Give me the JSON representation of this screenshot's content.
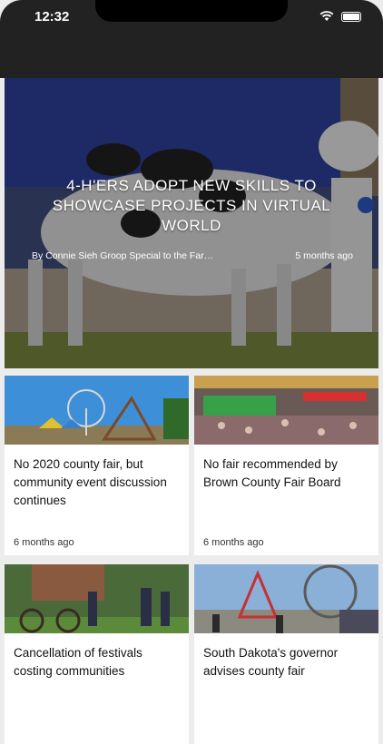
{
  "status_bar": {
    "time": "12:32"
  },
  "hero": {
    "title": "4-H'ERS ADOPT NEW SKILLS TO SHOWCASE PROJECTS IN VIRTUAL WORLD",
    "author": "By Connie Sieh Groop Special to the Far…",
    "age": "5 months ago"
  },
  "articles": [
    {
      "title": "No 2020 county fair, but community event discussion continues",
      "age": "6 months ago"
    },
    {
      "title": "No fair recommended by Brown County Fair Board",
      "age": "6 months ago"
    },
    {
      "title": "Cancellation of festivals costing communities",
      "age": ""
    },
    {
      "title": "South Dakota's governor advises county fair",
      "age": ""
    }
  ]
}
